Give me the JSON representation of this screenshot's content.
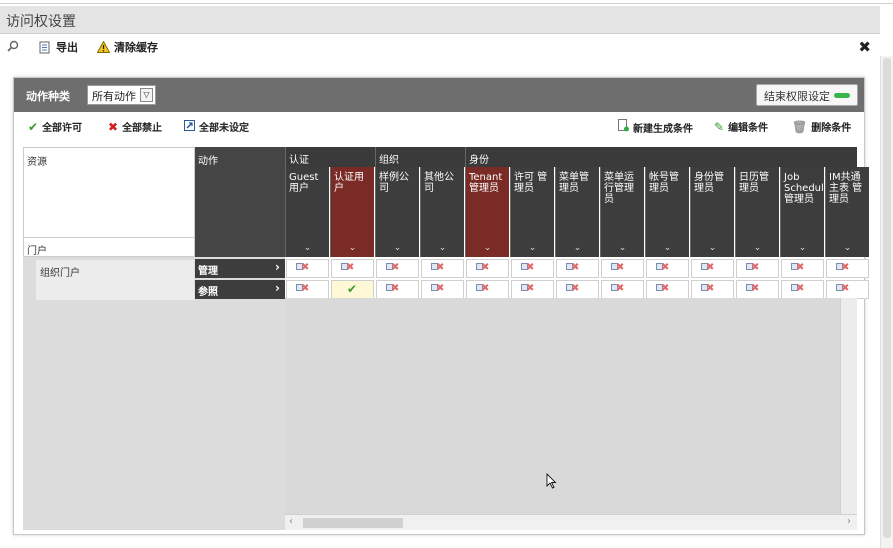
{
  "window": {
    "title": "访问权设置"
  },
  "toolbar": {
    "search_icon": "search-icon",
    "export_label": "导出",
    "clear_cache_label": "清除缓存"
  },
  "panel": {
    "action_type_label": "动作种类",
    "action_type_value": "所有动作",
    "end_button_label": "结束权限设定"
  },
  "actions": {
    "allow_all": "全部许可",
    "deny_all": "全部禁止",
    "unset_all": "全部未设定",
    "new_condition": "新建生成条件",
    "edit_condition": "编辑条件",
    "delete_condition": "删除条件"
  },
  "grid": {
    "resource_header": "资源",
    "action_header": "动作",
    "portal_label": "门户",
    "resource_row": "组织门户",
    "rows": [
      "管理",
      "参照"
    ],
    "groups": [
      "认证",
      "组织",
      "身份"
    ],
    "columns": [
      "Guest 用户",
      "认证用户",
      "样例公司",
      "其他公司",
      "Tenant 管理员",
      "许可 管理员",
      "菜单管理员",
      "菜单运行管理员",
      "帐号管理员",
      "身份管理员",
      "日历管理员",
      "Job Scheduler管理员",
      "IM共通主表 管理员"
    ],
    "allowed_cell": {
      "row": 1,
      "col": 1
    }
  },
  "colors": {
    "header_dark": "#3d3d3d",
    "header_red": "#7a2b26",
    "allow_green": "#3a9a2e",
    "deny_red": "#d42020"
  }
}
